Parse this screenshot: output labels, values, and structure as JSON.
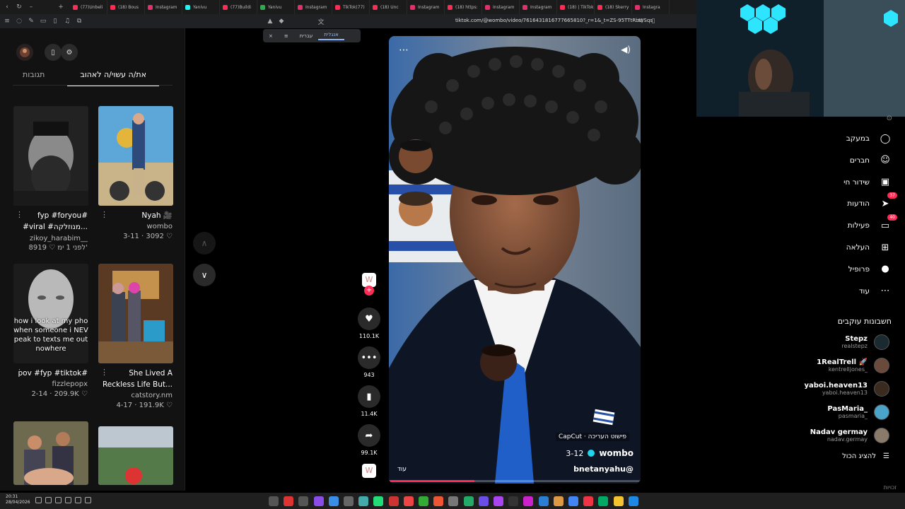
{
  "browser": {
    "tabs": [
      "(77)Unbeli",
      "(18) Bous",
      "Instagram",
      "Yanivu",
      "(77)Buildi",
      "Yanivu",
      "Instagram",
      "TikTok(77)",
      "(18) Unc",
      "Instagram",
      "(18) https:",
      "Instagram",
      "Instagram",
      "(18) | TikTok",
      "(18) Skerry",
      "Instagra"
    ],
    "tab_colors": [
      "#fe2c55",
      "#fe2c55",
      "#e1306c",
      "#25f4ee",
      "#fe2c55",
      "#34a853",
      "#e1306c",
      "#fe2c55",
      "#fe2c55",
      "#e1306c",
      "#fe2c55",
      "#e1306c",
      "#e1306c",
      "#fe2c55",
      "#fe2c55",
      "#e1306c"
    ],
    "url": "tiktok.com/@wombo/video/7616431816777665810?_r=1&_t=ZS-95TTtRbWSqs",
    "translate": {
      "lang1": "עברית",
      "lang2": "אנגלית"
    }
  },
  "left": {
    "tab_liked": "את/ה עשוי/ה לאהוב",
    "tab_replies": "תגובות",
    "cards": [
      {
        "caption": "fyp #foryou#",
        "caption2": "#viral #מנוזלקה...",
        "author": "zikoy_harabim__",
        "meta": "8919 ♡ לפני 1 ימ'"
      },
      {
        "caption": "Nyah 🎥",
        "caption2": "",
        "author": "wombo",
        "meta": "3-11 · 3092 ♡"
      },
      {
        "caption": "pov #fyp #tiktok#",
        "caption2": "",
        "author": "fizzlepopx",
        "meta": "2-14 · 209.9K ♡"
      },
      {
        "caption": "She Lived A",
        "caption2": "Reckless Life But...",
        "author": "catstory.nm",
        "meta": "4-17 · 191.9K ♡"
      }
    ],
    "overlay_text": [
      "how i look at my pho",
      "when someone i NEV",
      "peak to texts me out",
      "nowhere"
    ]
  },
  "video": {
    "username": "bnetanyahu@",
    "sound_author": "wombo",
    "date": "3-12",
    "capcut": "CapCut · פישוט העריכה",
    "more": "עוד",
    "actions": {
      "likes": "110.1K",
      "comments": "943",
      "saves": "11.4K",
      "shares": "99.1K"
    },
    "progress": 0.34
  },
  "right": {
    "nav": [
      {
        "label": "במעקב",
        "icon": "following-icon",
        "badge": ""
      },
      {
        "label": "חברים",
        "icon": "friends-icon",
        "badge": ""
      },
      {
        "label": "שידור חי",
        "icon": "live-icon",
        "badge": ""
      },
      {
        "label": "הודעות",
        "icon": "messages-icon",
        "badge": "37"
      },
      {
        "label": "פעילות",
        "icon": "activity-icon",
        "badge": "40"
      },
      {
        "label": "העלאה",
        "icon": "upload-icon",
        "badge": ""
      },
      {
        "label": "פרופיל",
        "icon": "profile-icon",
        "badge": ""
      },
      {
        "label": "עוד",
        "icon": "more-icon",
        "badge": ""
      }
    ],
    "following_title": "חשבונות עוקבים",
    "accounts": [
      {
        "name": "Stepz",
        "handle": "realstepz"
      },
      {
        "name": "1RealTrell 🚀",
        "handle": "kentrelljones_"
      },
      {
        "name": "yaboi.heaven13",
        "handle": "yaboi.heaven13"
      },
      {
        "name": "PasMaria_",
        "handle": "pasmaria_"
      },
      {
        "name": "Nadav germay",
        "handle": "nadav.germay"
      }
    ],
    "show_all": "להציג הכול",
    "corner": "זכויות"
  },
  "taskbar": {
    "time": "20:31",
    "date": "28/04/2026"
  }
}
